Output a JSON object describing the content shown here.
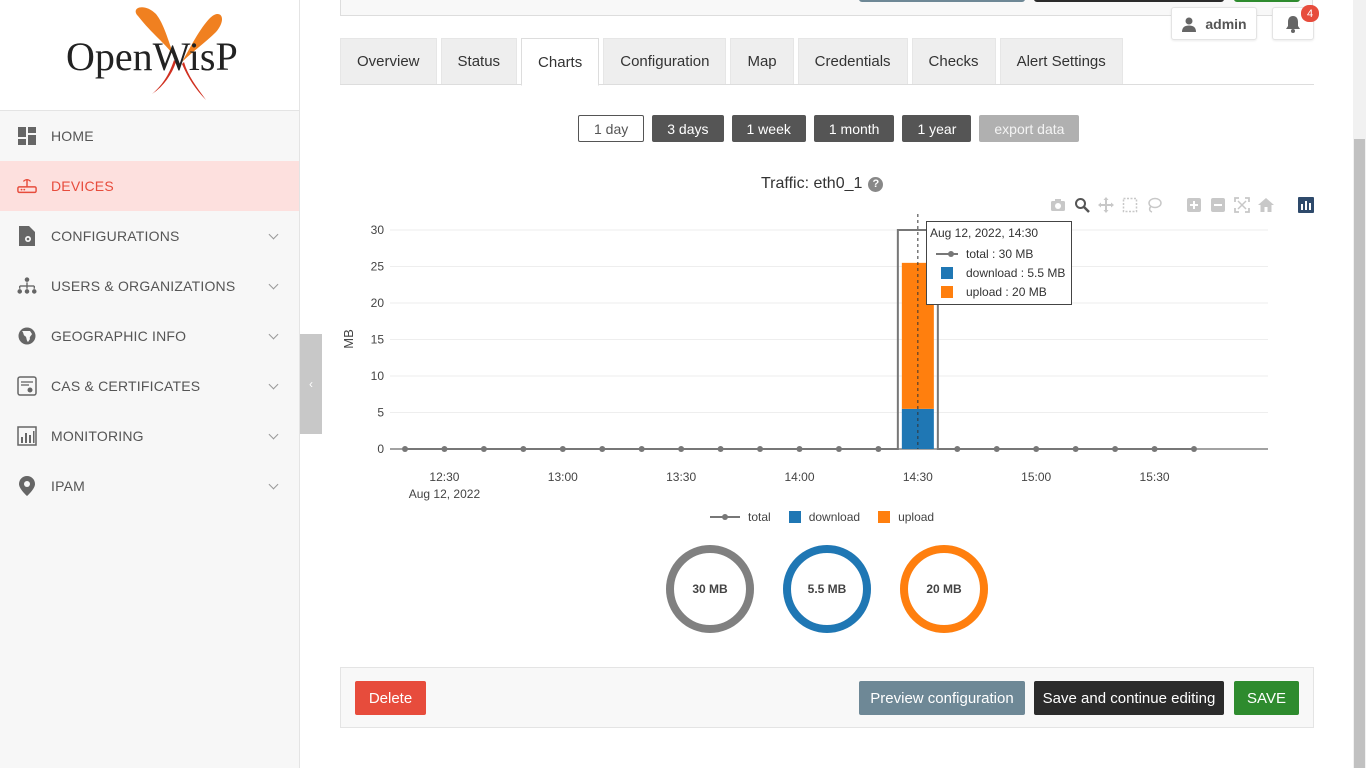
{
  "brand": {
    "logo_text": "OpenWisP"
  },
  "sidebar": {
    "items": [
      {
        "label": "HOME",
        "icon": "dashboard-icon",
        "active": false,
        "expandable": false
      },
      {
        "label": "DEVICES",
        "icon": "router-icon",
        "active": true,
        "expandable": false
      },
      {
        "label": "CONFIGURATIONS",
        "icon": "file-gear-icon",
        "active": false,
        "expandable": true
      },
      {
        "label": "USERS & ORGANIZATIONS",
        "icon": "org-tree-icon",
        "active": false,
        "expandable": true
      },
      {
        "label": "GEOGRAPHIC INFO",
        "icon": "globe-icon",
        "active": false,
        "expandable": true
      },
      {
        "label": "CAS & CERTIFICATES",
        "icon": "certificate-icon",
        "active": false,
        "expandable": true
      },
      {
        "label": "MONITORING",
        "icon": "monitoring-icon",
        "active": false,
        "expandable": true
      },
      {
        "label": "IPAM",
        "icon": "location-pin-icon",
        "active": false,
        "expandable": true
      }
    ],
    "collapse_glyph": "‹"
  },
  "header": {
    "user_label": "admin",
    "notifications_count": "4"
  },
  "tabs": [
    {
      "label": "Overview",
      "active": false
    },
    {
      "label": "Status",
      "active": false
    },
    {
      "label": "Charts",
      "active": true
    },
    {
      "label": "Configuration",
      "active": false
    },
    {
      "label": "Map",
      "active": false
    },
    {
      "label": "Credentials",
      "active": false
    },
    {
      "label": "Checks",
      "active": false
    },
    {
      "label": "Alert Settings",
      "active": false
    }
  ],
  "ranges": {
    "day": "1 day",
    "days3": "3 days",
    "week": "1 week",
    "month": "1 month",
    "year": "1 year",
    "export": "export data"
  },
  "chart_title": "Traffic: eth0_1",
  "tooltip": {
    "header": "Aug 12, 2022, 14:30",
    "total": "total : 30 MB",
    "download": "download : 5.5 MB",
    "upload": "upload : 20 MB"
  },
  "chart_data": {
    "type": "bar",
    "title": "Traffic: eth0_1",
    "ylabel": "MB",
    "xlabel": "",
    "ylim": [
      0,
      30
    ],
    "yticks": [
      0,
      5,
      10,
      15,
      20,
      25,
      30
    ],
    "xtick_labels": [
      "12:30",
      "13:00",
      "13:30",
      "14:00",
      "14:30",
      "15:00",
      "15:30"
    ],
    "xtick_sublabel": "Aug 12, 2022",
    "x": [
      "12:20",
      "12:30",
      "12:40",
      "12:50",
      "13:00",
      "13:10",
      "13:20",
      "13:30",
      "13:40",
      "13:50",
      "14:00",
      "14:10",
      "14:20",
      "14:30",
      "14:40",
      "14:50",
      "15:00",
      "15:10",
      "15:20",
      "15:30",
      "15:40"
    ],
    "series": [
      {
        "name": "total",
        "kind": "line",
        "color": "#777777",
        "values": [
          0,
          0,
          0,
          0,
          0,
          0,
          0,
          0,
          0,
          0,
          0,
          0,
          0,
          30,
          0,
          0,
          0,
          0,
          0,
          0,
          0
        ]
      },
      {
        "name": "download",
        "kind": "bar",
        "color": "#1f77b4",
        "values": [
          0,
          0,
          0,
          0,
          0,
          0,
          0,
          0,
          0,
          0,
          0,
          0,
          0,
          5.5,
          0,
          0,
          0,
          0,
          0,
          0,
          0
        ]
      },
      {
        "name": "upload",
        "kind": "bar",
        "color": "#ff7f0e",
        "values": [
          0,
          0,
          0,
          0,
          0,
          0,
          0,
          0,
          0,
          0,
          0,
          0,
          0,
          20,
          0,
          0,
          0,
          0,
          0,
          0,
          0
        ]
      }
    ],
    "legend": [
      "total",
      "download",
      "upload"
    ],
    "legend_position": "bottom-center"
  },
  "summary": [
    {
      "label": "30 MB",
      "color": "#808080",
      "fraction": 1.0
    },
    {
      "label": "5.5 MB",
      "color": "#1f77b4",
      "fraction": 1.0
    },
    {
      "label": "20 MB",
      "color": "#ff7f0e",
      "fraction": 1.0
    }
  ],
  "actions": {
    "delete": "Delete",
    "preview": "Preview configuration",
    "save_continue": "Save and continue editing",
    "save": "SAVE"
  },
  "colors": {
    "accent": "#e74c3c",
    "save": "#2e8b2e",
    "dark": "#2b2b2b",
    "preview": "#6e8896"
  }
}
